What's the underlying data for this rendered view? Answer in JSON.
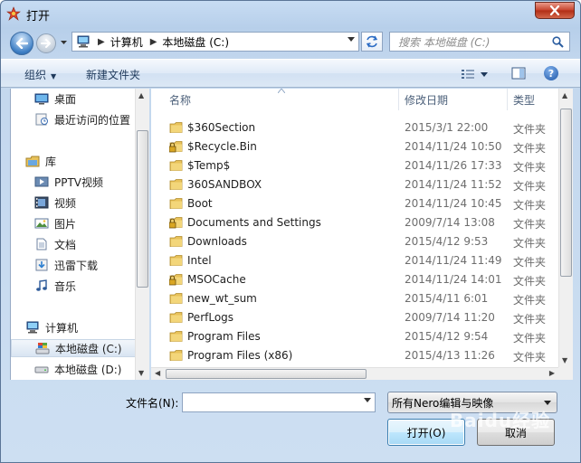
{
  "window": {
    "title": "打开"
  },
  "address": {
    "crumbs": [
      "计算机",
      "本地磁盘 (C:)"
    ]
  },
  "search": {
    "placeholder": "搜索 本地磁盘 (C:)"
  },
  "toolbar": {
    "organize": "组织",
    "new_folder": "新建文件夹"
  },
  "nav": {
    "items": [
      {
        "label": "桌面",
        "icon": "desktop-icon"
      },
      {
        "label": "最近访问的位置",
        "icon": "recent-places-icon"
      },
      {
        "label": "库",
        "icon": "library-icon"
      },
      {
        "label": "PPTV视频",
        "icon": "video-library-icon"
      },
      {
        "label": "视频",
        "icon": "video-icon"
      },
      {
        "label": "图片",
        "icon": "pictures-icon"
      },
      {
        "label": "文档",
        "icon": "documents-icon"
      },
      {
        "label": "迅雷下载",
        "icon": "download-library-icon"
      },
      {
        "label": "音乐",
        "icon": "music-icon"
      },
      {
        "label": "计算机",
        "icon": "computer-icon"
      },
      {
        "label": "本地磁盘 (C:)",
        "icon": "system-drive-icon"
      },
      {
        "label": "本地磁盘 (D:)",
        "icon": "drive-icon"
      }
    ]
  },
  "columns": {
    "name": "名称",
    "modified": "修改日期",
    "type": "类型"
  },
  "files": [
    {
      "name": "$360Section",
      "date": "2015/3/1 22:00",
      "type": "文件夹",
      "locked": false
    },
    {
      "name": "$Recycle.Bin",
      "date": "2014/11/24 10:50",
      "type": "文件夹",
      "locked": true
    },
    {
      "name": "$Temp$",
      "date": "2014/11/26 17:33",
      "type": "文件夹",
      "locked": false
    },
    {
      "name": "360SANDBOX",
      "date": "2014/11/24 11:52",
      "type": "文件夹",
      "locked": false
    },
    {
      "name": "Boot",
      "date": "2014/11/24 10:45",
      "type": "文件夹",
      "locked": false
    },
    {
      "name": "Documents and Settings",
      "date": "2009/7/14 13:08",
      "type": "文件夹",
      "locked": true
    },
    {
      "name": "Downloads",
      "date": "2015/4/12 9:53",
      "type": "文件夹",
      "locked": false
    },
    {
      "name": "Intel",
      "date": "2014/11/24 11:49",
      "type": "文件夹",
      "locked": false
    },
    {
      "name": "MSOCache",
      "date": "2014/11/24 14:01",
      "type": "文件夹",
      "locked": true
    },
    {
      "name": "new_wt_sum",
      "date": "2015/4/11 6:01",
      "type": "文件夹",
      "locked": false
    },
    {
      "name": "PerfLogs",
      "date": "2009/7/14 11:20",
      "type": "文件夹",
      "locked": false
    },
    {
      "name": "Program Files",
      "date": "2015/4/12 9:54",
      "type": "文件夹",
      "locked": false
    },
    {
      "name": "Program Files (x86)",
      "date": "2015/4/13 11:26",
      "type": "文件夹",
      "locked": false
    }
  ],
  "bottom": {
    "filename_label": "文件名(N):",
    "filename_value": "",
    "filetype_value": "所有Nero编辑与映像",
    "open_label": "打开(O)",
    "cancel_label": "取消"
  },
  "watermark": "Baidu经验",
  "colors": {
    "folder": "#e8c25a",
    "selection": "#d9e5f2",
    "accent": "#1f57a7"
  }
}
